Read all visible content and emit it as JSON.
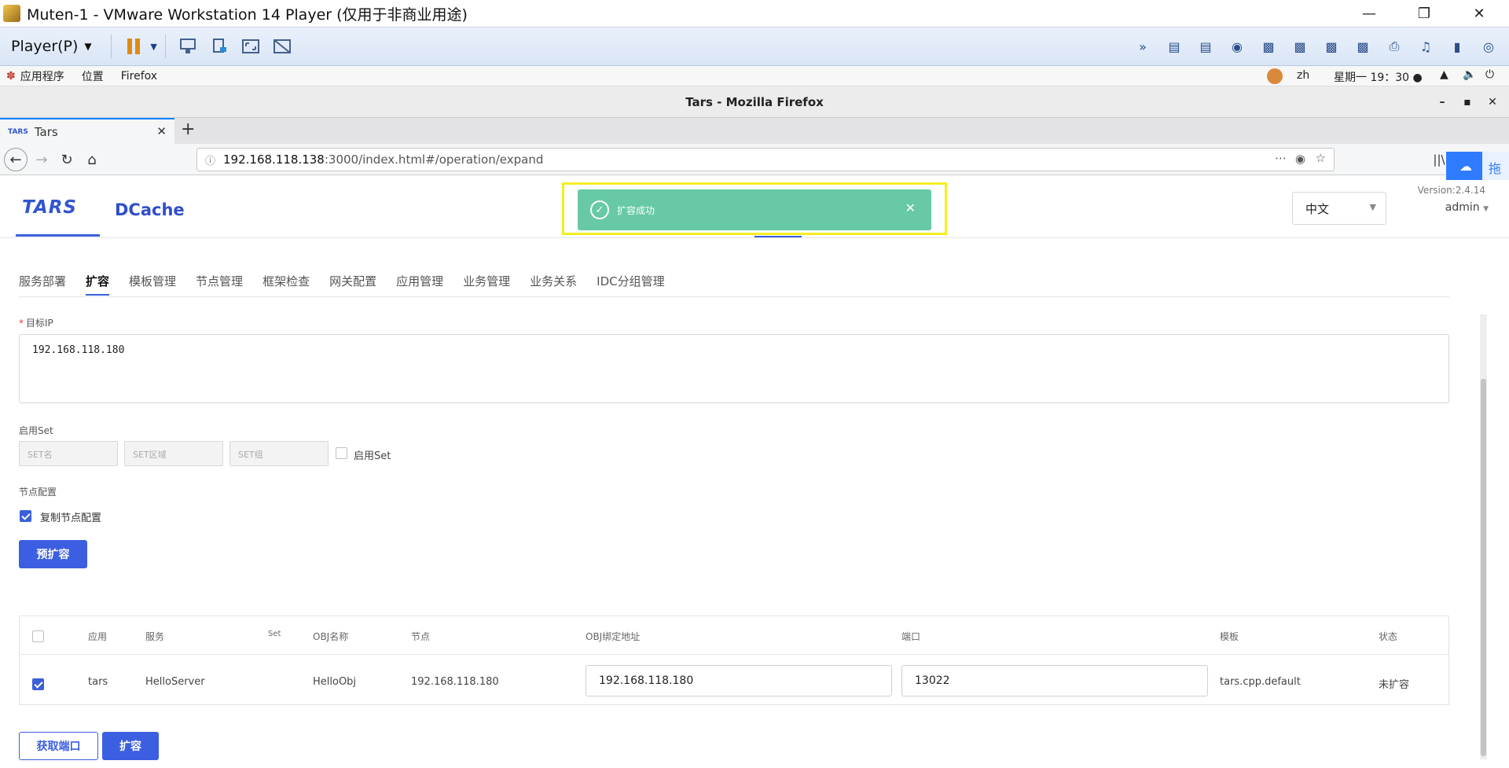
{
  "vmware": {
    "title": "Muten-1 - VMware Workstation 14 Player (仅用于非商业用途)",
    "player_menu": "Player(P)",
    "window_controls": [
      "minimize-icon",
      "restore-icon",
      "close-icon"
    ]
  },
  "gnome": {
    "apps_menu": "应用程序",
    "places_menu": "位置",
    "firefox_menu": "Firefox",
    "lang": "zh",
    "clock": "星期一 19：30 ●"
  },
  "firefox": {
    "window_title": "Tars - Mozilla Firefox",
    "tab_title": "Tars",
    "url_host": "192.168.118.138",
    "url_rest": ":3000/index.html#/operation/expand"
  },
  "header": {
    "brand_tars": "TARS",
    "brand_dcache": "DCache",
    "language": "中文",
    "version": "Version:2.4.14",
    "user": "admin"
  },
  "baidu_widget": {
    "text": "拖"
  },
  "toast": {
    "message": "扩容成功",
    "color": "#67c9a5"
  },
  "subtabs": [
    "服务部署",
    "扩容",
    "模板管理",
    "节点管理",
    "框架检查",
    "网关配置",
    "应用管理",
    "业务管理",
    "业务关系",
    "IDC分组管理"
  ],
  "form": {
    "target_ip_label": "目标IP",
    "target_ip_value": "192.168.118.180",
    "set_label": "启用Set",
    "set_name_ph": "SET名",
    "set_area_ph": "SET区域",
    "set_group_ph": "SET组",
    "enable_set_label": "启用Set",
    "node_config_label": "节点配置",
    "copy_node_label": "复制节点配置",
    "pre_expand_button": "预扩容"
  },
  "table": {
    "headers": [
      "应用",
      "服务",
      "Set",
      "OBJ名称",
      "节点",
      "OBJ绑定地址",
      "端口",
      "模板",
      "状态"
    ],
    "rows": [
      {
        "app": "tars",
        "server": "HelloServer",
        "set": "",
        "obj": "HelloObj",
        "node": "192.168.118.180",
        "bind": "192.168.118.180",
        "port": "13022",
        "template": "tars.cpp.default",
        "status": "未扩容"
      }
    ]
  },
  "actions": {
    "get_port": "获取端口",
    "expand": "扩容"
  },
  "colors": {
    "accent": "#3c5ee0",
    "highlight": "#f5ee23"
  }
}
